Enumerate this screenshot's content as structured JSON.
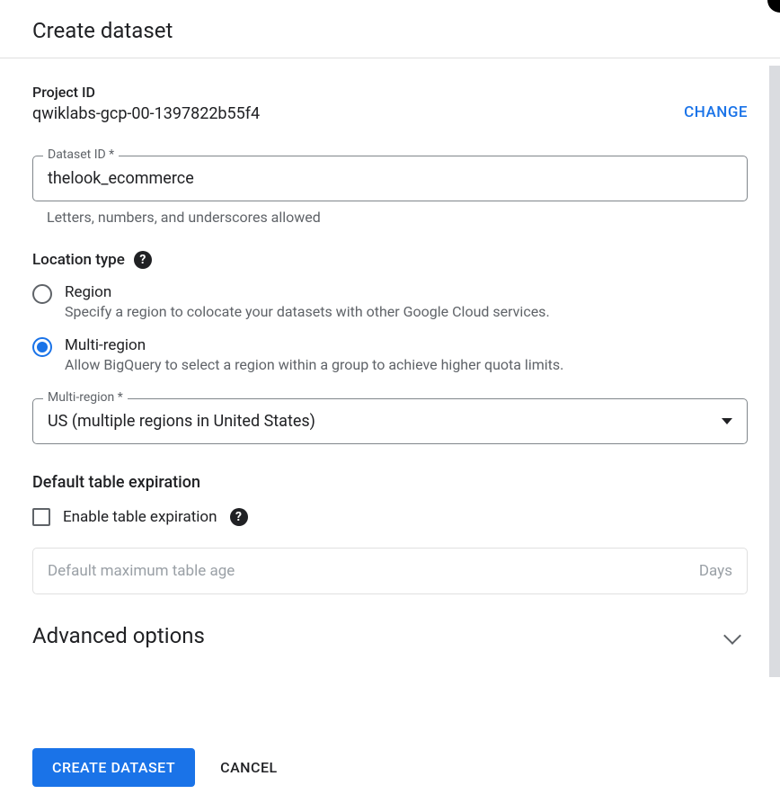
{
  "header": {
    "title": "Create dataset"
  },
  "project": {
    "label": "Project ID",
    "value": "qwiklabs-gcp-00-1397822b55f4",
    "change_label": "CHANGE"
  },
  "dataset_id": {
    "label": "Dataset ID *",
    "value": "thelook_ecommerce",
    "helper": "Letters, numbers, and underscores allowed"
  },
  "location": {
    "label": "Location type",
    "options": [
      {
        "title": "Region",
        "desc": "Specify a region to colocate your datasets with other Google Cloud services.",
        "selected": false
      },
      {
        "title": "Multi-region",
        "desc": "Allow BigQuery to select a region within a group to achieve higher quota limits.",
        "selected": true
      }
    ]
  },
  "multi_region": {
    "label": "Multi-region *",
    "value": "US (multiple regions in United States)"
  },
  "expiration": {
    "heading": "Default table expiration",
    "checkbox_label": "Enable table expiration",
    "placeholder": "Default maximum table age",
    "unit": "Days"
  },
  "advanced": {
    "label": "Advanced options"
  },
  "footer": {
    "primary": "CREATE DATASET",
    "secondary": "CANCEL"
  }
}
